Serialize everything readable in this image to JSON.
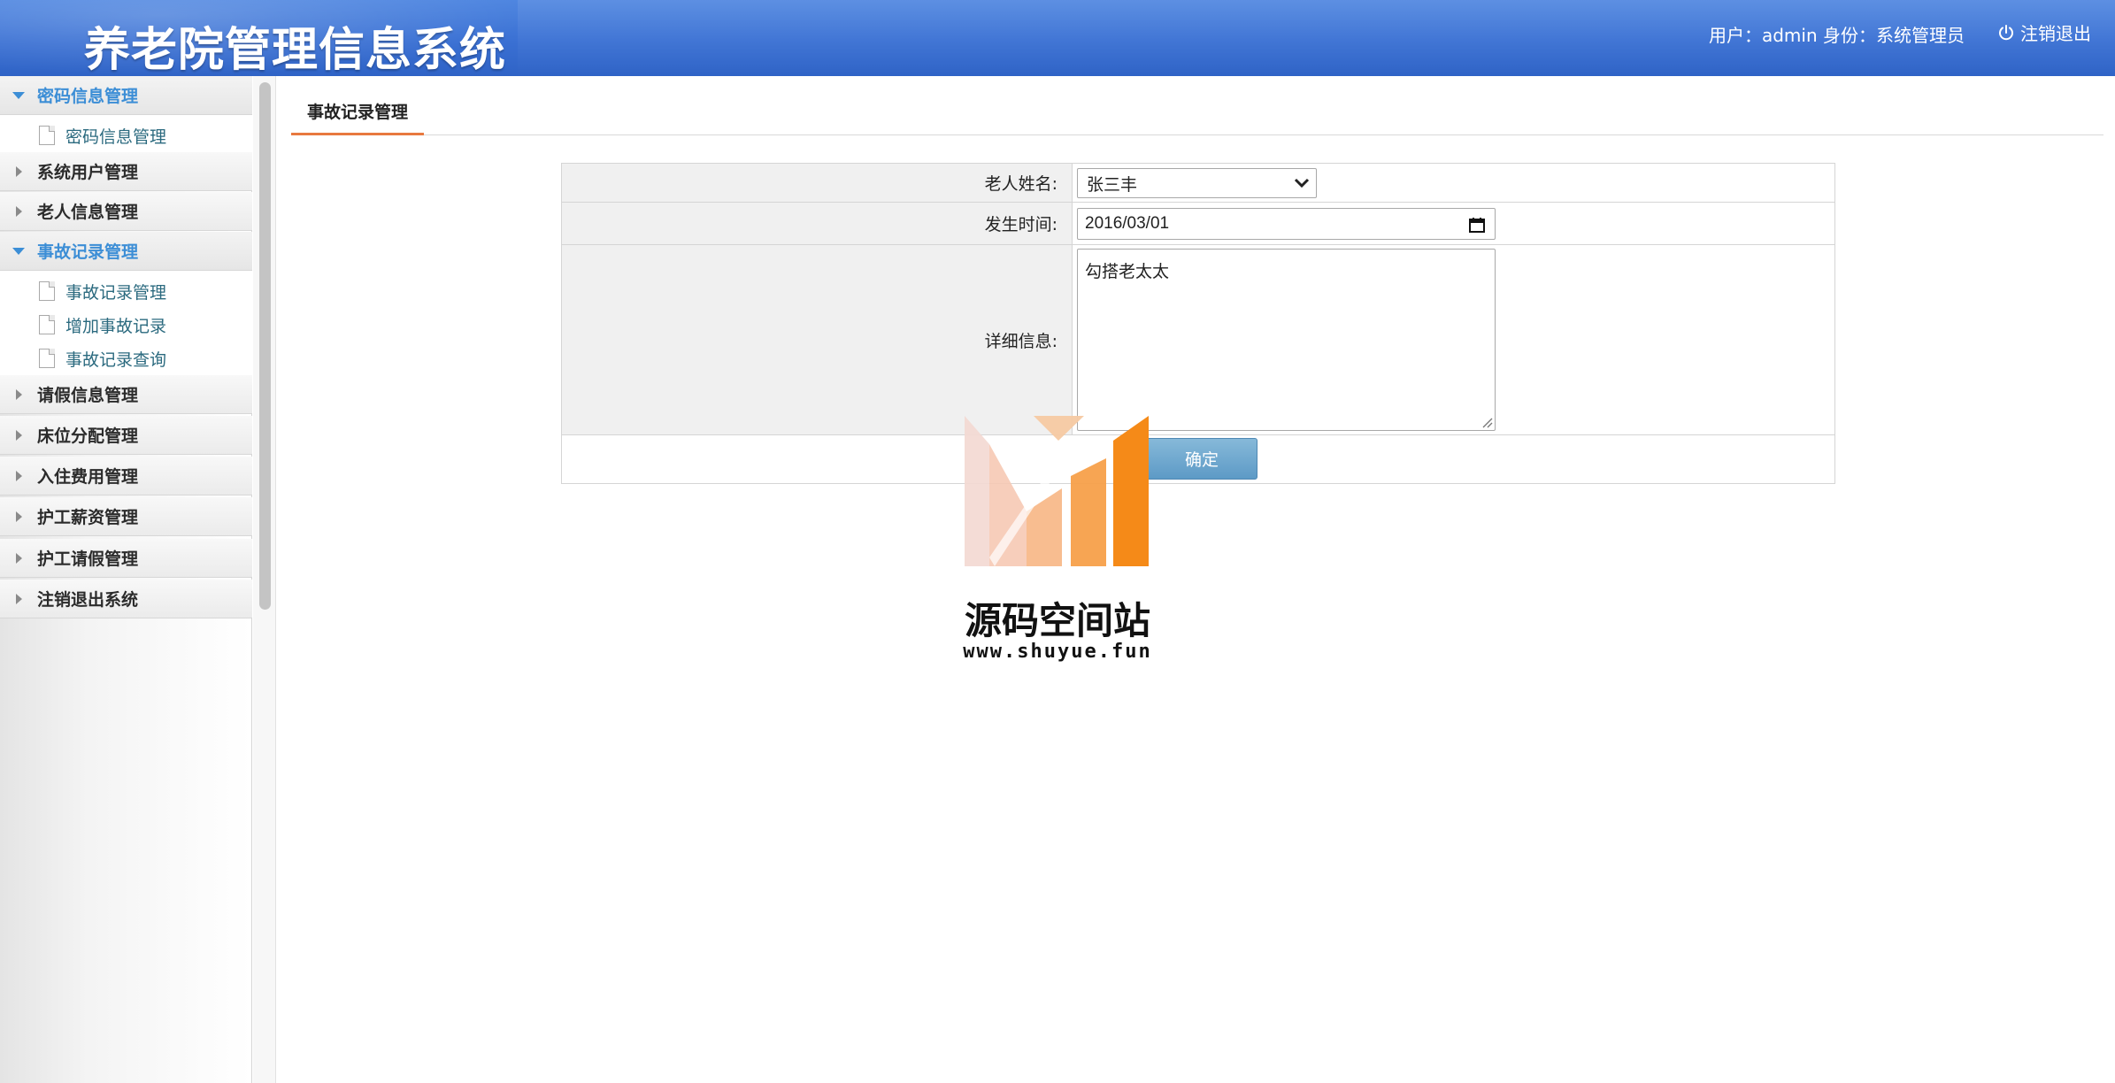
{
  "header": {
    "title": "养老院管理信息系统",
    "user_info": "用户：admin 身份：系统管理员",
    "logout_label": "注销退出"
  },
  "sidebar": {
    "groups": [
      {
        "label": "密码信息管理",
        "expanded": true,
        "items": [
          {
            "label": "密码信息管理"
          }
        ]
      },
      {
        "label": "系统用户管理",
        "expanded": false
      },
      {
        "label": "老人信息管理",
        "expanded": false
      },
      {
        "label": "事故记录管理",
        "expanded": true,
        "items": [
          {
            "label": "事故记录管理"
          },
          {
            "label": "增加事故记录"
          },
          {
            "label": "事故记录查询"
          }
        ]
      },
      {
        "label": "请假信息管理",
        "expanded": false
      },
      {
        "label": "床位分配管理",
        "expanded": false
      },
      {
        "label": "入住费用管理",
        "expanded": false
      },
      {
        "label": "护工薪资管理",
        "expanded": false
      },
      {
        "label": "护工请假管理",
        "expanded": false
      },
      {
        "label": "注销退出系统",
        "expanded": false
      }
    ]
  },
  "tabs": {
    "active_label": "事故记录管理"
  },
  "form": {
    "elder_name_label": "老人姓名:",
    "elder_name_value": "张三丰",
    "time_label": "发生时间:",
    "time_value": "2016/03/01",
    "detail_label": "详细信息:",
    "detail_value": "勾搭老太太",
    "confirm_label": "确定"
  },
  "watermark": {
    "name": "源码空间站",
    "url": "www.shuyue.fun"
  },
  "colors": {
    "header_blue": "#3a70d3",
    "menu_active": "#3c8ed6",
    "tab_underline": "#e8793f",
    "button_blue": "#5d9ac6"
  }
}
